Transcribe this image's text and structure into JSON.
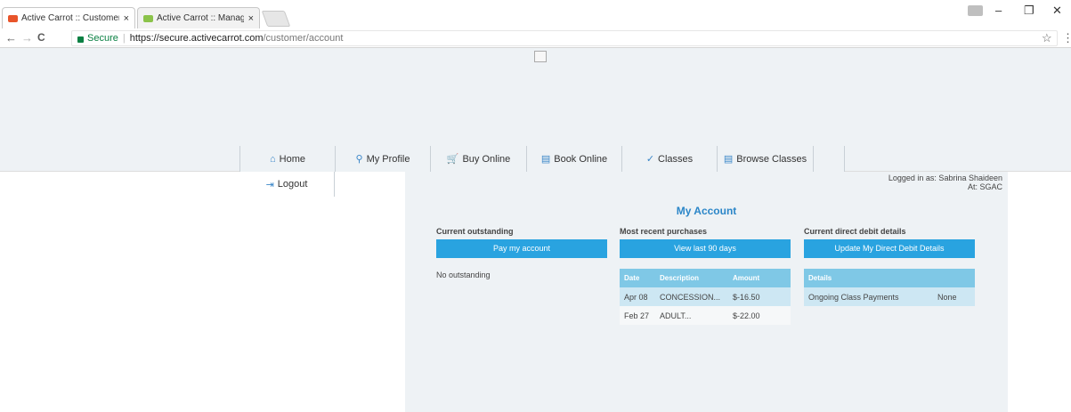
{
  "browser": {
    "tabs": [
      {
        "title": "Active Carrot :: Customer",
        "close": "×",
        "fav_color": "#e8542a"
      },
      {
        "title": "Active Carrot :: Manager",
        "close": "×",
        "fav_color": "#8bc34a"
      }
    ],
    "window_controls": {
      "minimize": "–",
      "restore": "❐",
      "close": "✕"
    },
    "address": {
      "secure_label": "Secure",
      "separator": "|",
      "url_host": "https://secure.activecarrot.com",
      "url_path": "/customer/account"
    },
    "nav_icons": {
      "back": "←",
      "forward": "→",
      "reload": "C"
    },
    "star_icon": "☆",
    "menu_icon": "⋮"
  },
  "nav": {
    "items": [
      {
        "label": "Home",
        "icon": "⌂"
      },
      {
        "label": "My Profile",
        "icon": "⚲"
      },
      {
        "label": "Buy Online",
        "icon": "🛒"
      },
      {
        "label": "Book Online",
        "icon": "▤"
      },
      {
        "label": "Classes",
        "icon": "✓"
      },
      {
        "label": "Browse Classes",
        "icon": "▤"
      }
    ],
    "logout": {
      "label": "Logout",
      "icon": "⇥"
    }
  },
  "account": {
    "logged_in_line": "Logged in as: Sabrina Shaideen",
    "at_line": "At: SGAC",
    "title": "My Account",
    "outstanding": {
      "heading": "Current outstanding",
      "button": "Pay my account",
      "note": "No outstanding"
    },
    "purchases": {
      "heading": "Most recent purchases",
      "button": "View last 90 days",
      "columns": [
        "Date",
        "Description",
        "Amount"
      ],
      "rows": [
        [
          "Apr 08",
          "CONCESSION...",
          "$-16.50"
        ],
        [
          "Feb 27",
          "ADULT...",
          "$-22.00"
        ]
      ]
    },
    "direct_debit": {
      "heading": "Current direct debit details",
      "button": "Update My Direct Debit Details",
      "columns": [
        "Details",
        ""
      ],
      "rows": [
        [
          "Ongoing Class Payments",
          "None"
        ]
      ]
    }
  },
  "colors": {
    "accent": "#29a3e0",
    "title_blue": "#2b86c8",
    "banner_bg": "#eef2f5"
  }
}
